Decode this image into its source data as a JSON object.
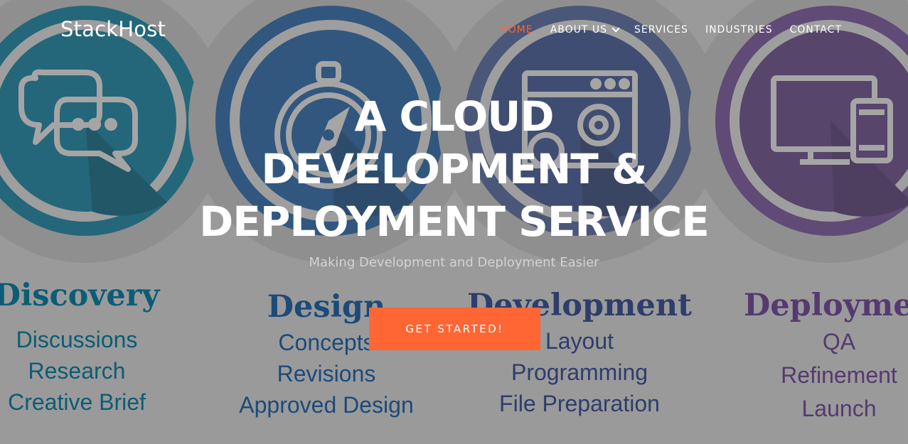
{
  "header": {
    "logo": "StackHost",
    "nav": [
      {
        "label": "HOME",
        "active": true
      },
      {
        "label": "ABOUT US",
        "has_dropdown": true
      },
      {
        "label": "SERVICES"
      },
      {
        "label": "INDUSTRIES"
      },
      {
        "label": "CONTACT"
      }
    ]
  },
  "hero": {
    "title_lines": [
      "A CLOUD",
      "DEVELOPMENT &",
      "DEPLOYMENT SERVICE"
    ],
    "subtitle": "Making Development and Deployment Easier",
    "cta_label": "GET STARTED!"
  },
  "phases": [
    {
      "title": "Discovery",
      "items": [
        "Discussions",
        "Research",
        "Creative Brief"
      ],
      "icon": "chat-bubbles-icon",
      "color": "#0b5d75"
    },
    {
      "title": "Design",
      "items": [
        "Concepts",
        "Revisions",
        "Approved Design"
      ],
      "icon": "compass-icon",
      "color": "#1c4a7a"
    },
    {
      "title": "Development",
      "items": [
        "Layout",
        "Programming",
        "File Preparation"
      ],
      "icon": "browser-gear-icon",
      "color": "#2e3d6b"
    },
    {
      "title": "Deployment",
      "items": [
        "QA",
        "Refinement",
        "Launch"
      ],
      "icon": "devices-icon",
      "color": "#553a70"
    }
  ],
  "colors": {
    "accent": "#ff6634",
    "nav_text": "#ffffff",
    "background": "#9b9b9b"
  }
}
